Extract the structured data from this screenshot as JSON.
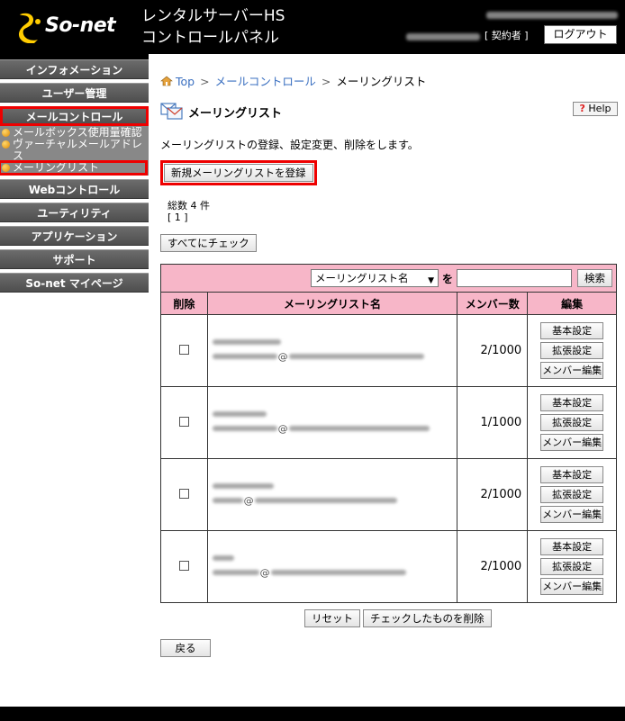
{
  "header": {
    "logo_text": "So-net",
    "title_line1": "レンタルサーバーHS",
    "title_line2": "コントロールパネル",
    "contract_label": "[ 契約者 ]",
    "logout_label": "ログアウト"
  },
  "sidebar": {
    "items": [
      {
        "label": "インフォメーション"
      },
      {
        "label": "ユーザー管理"
      },
      {
        "label": "メールコントロール"
      },
      {
        "label": "Webコントロール"
      },
      {
        "label": "ユーティリティ"
      },
      {
        "label": "アプリケーション"
      },
      {
        "label": "サポート"
      },
      {
        "label": "So-net マイページ"
      }
    ],
    "mail_sub": [
      {
        "label": "メールボックス使用量確認"
      },
      {
        "label": "ヴァーチャルメールアドレス"
      },
      {
        "label": "メーリングリスト"
      }
    ]
  },
  "breadcrumb": {
    "top": "Top",
    "mail_control": "メールコントロール",
    "current": "メーリングリスト"
  },
  "page": {
    "title": "メーリングリスト",
    "help": "Help",
    "help_mark": "?",
    "description": "メーリングリストの登録、設定変更、削除をします。",
    "new_button": "新規メーリングリストを登録",
    "total": "総数 4 件",
    "pages": "[ 1 ]",
    "check_all": "すべてにチェック"
  },
  "search": {
    "field_selected": "メーリングリスト名",
    "particle": "を",
    "button": "検索"
  },
  "table": {
    "headers": [
      "削除",
      "メーリングリスト名",
      "メンバー数",
      "編集"
    ],
    "rows": [
      {
        "members": "2/1000"
      },
      {
        "members": "1/1000"
      },
      {
        "members": "2/1000"
      },
      {
        "members": "2/1000"
      }
    ],
    "op_basic": "基本設定",
    "op_ext": "拡張設定",
    "op_members": "メンバー編集"
  },
  "actions": {
    "reset": "リセット",
    "delete_checked": "チェックしたものを削除",
    "back": "戻る"
  },
  "colors": {
    "header_bg": "#000000",
    "table_header_pink": "#f7b6c8",
    "highlight_red": "#ee0000",
    "link_blue": "#3a6fc0"
  }
}
